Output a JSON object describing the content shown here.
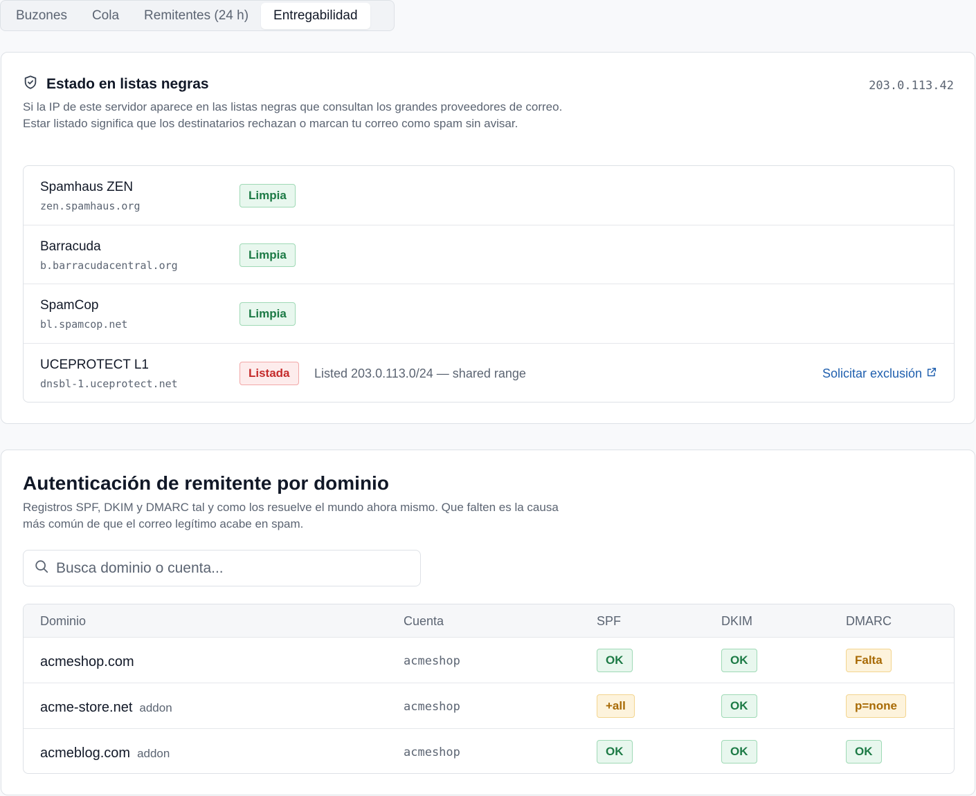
{
  "tabs": [
    {
      "label": "Buzones",
      "active": false
    },
    {
      "label": "Cola",
      "active": false
    },
    {
      "label": "Remitentes (24 h)",
      "active": false
    },
    {
      "label": "Entregabilidad",
      "active": true
    }
  ],
  "blacklist": {
    "title": "Estado en listas negras",
    "icon": "shield-check-icon",
    "ip": "203.0.113.42",
    "description": "Si la IP de este servidor aparece en las listas negras que consultan los grandes proveedores de correo. Estar listado significa que los destinatarios rechazan o marcan tu correo como spam sin avisar.",
    "rows": [
      {
        "name": "Spamhaus ZEN",
        "host": "zen.spamhaus.org",
        "status": "Limpia",
        "tone": "ok",
        "note": "",
        "action": ""
      },
      {
        "name": "Barracuda",
        "host": "b.barracudacentral.org",
        "status": "Limpia",
        "tone": "ok",
        "note": "",
        "action": ""
      },
      {
        "name": "SpamCop",
        "host": "bl.spamcop.net",
        "status": "Limpia",
        "tone": "ok",
        "note": "",
        "action": ""
      },
      {
        "name": "UCEPROTECT L1",
        "host": "dnsbl-1.uceprotect.net",
        "status": "Listada",
        "tone": "bad",
        "note": "Listed 203.0.113.0/24 — shared range",
        "action": "Solicitar exclusión"
      }
    ]
  },
  "auth": {
    "title": "Autenticación de remitente por dominio",
    "description": "Registros SPF, DKIM y DMARC tal y como los resuelve el mundo ahora mismo. Que falten es la causa más común de que el correo legítimo acabe en spam.",
    "search_placeholder": "Busca dominio o cuenta...",
    "columns": {
      "domain": "Dominio",
      "account": "Cuenta",
      "spf": "SPF",
      "dkim": "DKIM",
      "dmarc": "DMARC"
    },
    "rows": [
      {
        "domain": "acmeshop.com",
        "addon": "",
        "account": "acmeshop",
        "spf": {
          "label": "OK",
          "tone": "ok"
        },
        "dkim": {
          "label": "OK",
          "tone": "ok"
        },
        "dmarc": {
          "label": "Falta",
          "tone": "warn"
        }
      },
      {
        "domain": "acme-store.net",
        "addon": "addon",
        "account": "acmeshop",
        "spf": {
          "label": "+all",
          "tone": "warn"
        },
        "dkim": {
          "label": "OK",
          "tone": "ok"
        },
        "dmarc": {
          "label": "p=none",
          "tone": "warn"
        }
      },
      {
        "domain": "acmeblog.com",
        "addon": "addon",
        "account": "acmeshop",
        "spf": {
          "label": "OK",
          "tone": "ok"
        },
        "dkim": {
          "label": "OK",
          "tone": "ok"
        },
        "dmarc": {
          "label": "OK",
          "tone": "ok"
        }
      }
    ]
  },
  "colors": {
    "ok": "#1c7a45",
    "bad": "#c42b2b",
    "warn": "#a86a05",
    "link": "#1f5fae"
  }
}
